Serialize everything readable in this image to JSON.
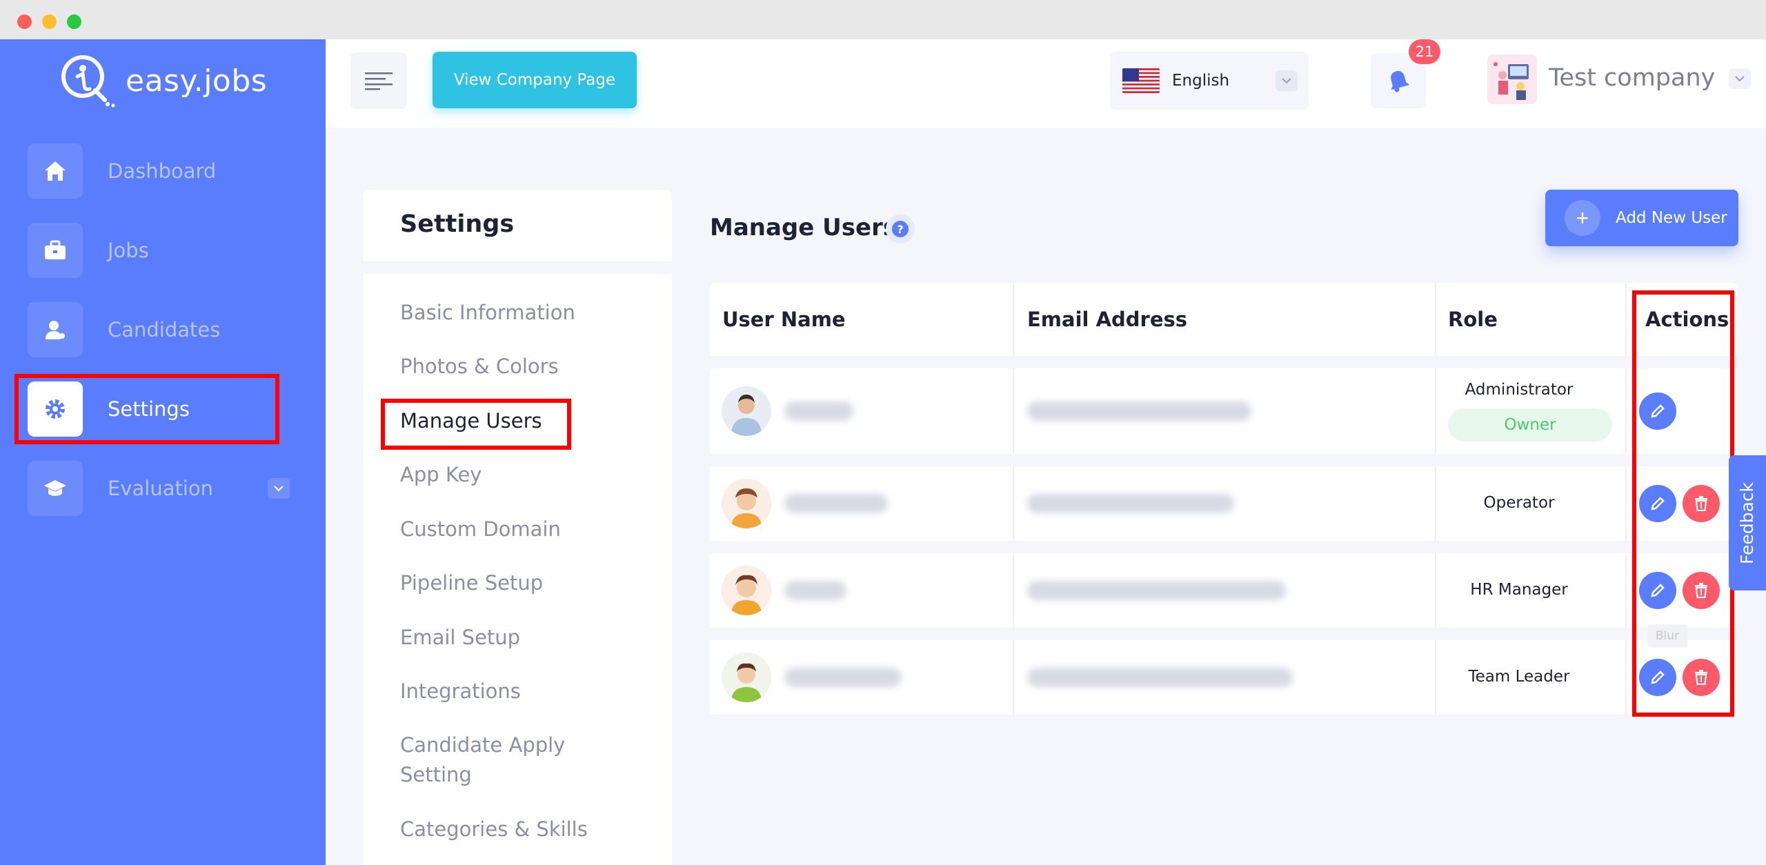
{
  "app": {
    "name": "easy.jobs"
  },
  "sidebar": {
    "items": [
      {
        "label": "Dashboard",
        "icon": "home-icon"
      },
      {
        "label": "Jobs",
        "icon": "briefcase-icon"
      },
      {
        "label": "Candidates",
        "icon": "user-icon"
      },
      {
        "label": "Settings",
        "icon": "gear-icon",
        "active": true
      },
      {
        "label": "Evaluation",
        "icon": "graduation-cap-icon",
        "has_dropdown": true
      }
    ]
  },
  "header": {
    "view_company_label": "View Company Page",
    "language": "English",
    "notification_count": "21",
    "company_name": "Test company"
  },
  "settings": {
    "title": "Settings",
    "menu": [
      {
        "label": "Basic Information"
      },
      {
        "label": "Photos & Colors"
      },
      {
        "label": "Manage Users",
        "active": true
      },
      {
        "label": "App Key"
      },
      {
        "label": "Custom Domain"
      },
      {
        "label": "Pipeline Setup"
      },
      {
        "label": "Email Setup"
      },
      {
        "label": "Integrations"
      },
      {
        "label": "Candidate Apply Setting"
      },
      {
        "label": "Categories & Skills"
      }
    ]
  },
  "main": {
    "title": "Manage Users",
    "help_glyph": "?",
    "add_button_label": "Add New User",
    "table": {
      "headers": [
        "User Name",
        "Email Address",
        "Role",
        "Actions"
      ],
      "rows": [
        {
          "role": "Administrator",
          "badge": "Owner",
          "actions": [
            "edit"
          ]
        },
        {
          "role": "Operator",
          "actions": [
            "edit",
            "delete"
          ]
        },
        {
          "role": "HR Manager",
          "actions": [
            "edit",
            "delete"
          ]
        },
        {
          "role": "Team Leader",
          "actions": [
            "edit",
            "delete"
          ]
        }
      ]
    },
    "tooltip": "Blur"
  },
  "feedback_label": "Feedback",
  "colors": {
    "sidebar": "#597dfc",
    "primary": "#597dfc",
    "accent_cyan": "#2ec3e3",
    "danger": "#ff5a6a",
    "success": "#4cc870",
    "highlight": "#ff0000"
  }
}
